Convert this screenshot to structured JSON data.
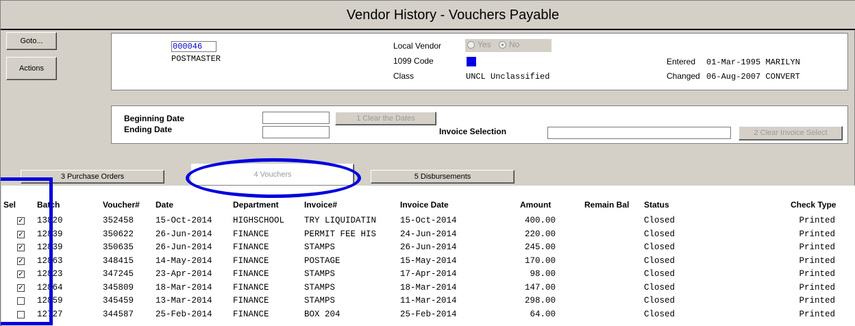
{
  "window": {
    "title": "Vendor History - Vouchers Payable"
  },
  "side_buttons": {
    "goto": "Goto...",
    "actions": "Actions"
  },
  "vendor": {
    "number": "000046",
    "name": "POSTMASTER",
    "local_vendor_label": "Local Vendor",
    "yes_label": "Yes",
    "no_label": "No",
    "code_1099_label": "1099 Code",
    "class_label": "Class",
    "class_value": "UNCL Unclassified",
    "entered_label": "Entered",
    "entered_value": "01-Mar-1995 MARILYN",
    "changed_label": "Changed",
    "changed_value": "06-Aug-2007 CONVERT",
    "code_1099_color": "#0000e6"
  },
  "filters": {
    "beginning_date_label": "Beginning Date",
    "ending_date_label": "Ending Date",
    "clear_dates_button": "1 Clear the Dates",
    "invoice_selection_label": "Invoice Selection",
    "clear_invoice_button": "2 Clear Invoice Select"
  },
  "tabs": {
    "purchase_orders": "3 Purchase Orders",
    "vouchers": "4 Vouchers",
    "disbursements": "5 Disbursements"
  },
  "table": {
    "headers": {
      "sel": "Sel",
      "batch": "Batch",
      "voucher": "Voucher#",
      "date": "Date",
      "department": "Department",
      "invoice": "Invoice#",
      "invoice_date": "Invoice Date",
      "amount": "Amount",
      "remain_bal": "Remain Bal",
      "status": "Status",
      "check_type": "Check Type"
    },
    "rows": [
      {
        "sel": true,
        "batch": "13820",
        "voucher": "352458",
        "date": "15-Oct-2014",
        "department": "HIGHSCHOOL",
        "invoice": "TRY LIQUIDATIN",
        "invoice_date": "15-Oct-2014",
        "amount": "400.00",
        "status": "Closed",
        "check_type": "Printed"
      },
      {
        "sel": true,
        "batch": "12839",
        "voucher": "350622",
        "date": "26-Jun-2014",
        "department": "FINANCE",
        "invoice": "PERMIT FEE HIS",
        "invoice_date": "24-Jun-2014",
        "amount": "220.00",
        "status": "Closed",
        "check_type": "Printed"
      },
      {
        "sel": true,
        "batch": "12839",
        "voucher": "350635",
        "date": "26-Jun-2014",
        "department": "FINANCE",
        "invoice": "STAMPS",
        "invoice_date": "26-Jun-2014",
        "amount": "245.00",
        "status": "Closed",
        "check_type": "Printed"
      },
      {
        "sel": true,
        "batch": "12863",
        "voucher": "348415",
        "date": "14-May-2014",
        "department": "FINANCE",
        "invoice": "POSTAGE",
        "invoice_date": "15-May-2014",
        "amount": "170.00",
        "status": "Closed",
        "check_type": "Printed"
      },
      {
        "sel": true,
        "batch": "12823",
        "voucher": "347245",
        "date": "23-Apr-2014",
        "department": "FINANCE",
        "invoice": "STAMPS",
        "invoice_date": "17-Apr-2014",
        "amount": "98.00",
        "status": "Closed",
        "check_type": "Printed"
      },
      {
        "sel": true,
        "batch": "12864",
        "voucher": "345809",
        "date": "18-Mar-2014",
        "department": "FINANCE",
        "invoice": "STAMPS",
        "invoice_date": "18-Mar-2014",
        "amount": "147.00",
        "status": "Closed",
        "check_type": "Printed"
      },
      {
        "sel": false,
        "batch": "12859",
        "voucher": "345459",
        "date": "13-Mar-2014",
        "department": "FINANCE",
        "invoice": "STAMPS",
        "invoice_date": "11-Mar-2014",
        "amount": "298.00",
        "status": "Closed",
        "check_type": "Printed"
      },
      {
        "sel": false,
        "batch": "12727",
        "voucher": "344587",
        "date": "25-Feb-2014",
        "department": "FINANCE",
        "invoice": "BOX 204",
        "invoice_date": "25-Feb-2014",
        "amount": "64.00",
        "status": "Closed",
        "check_type": "Printed"
      }
    ]
  },
  "annotation_color": "#0000e0"
}
